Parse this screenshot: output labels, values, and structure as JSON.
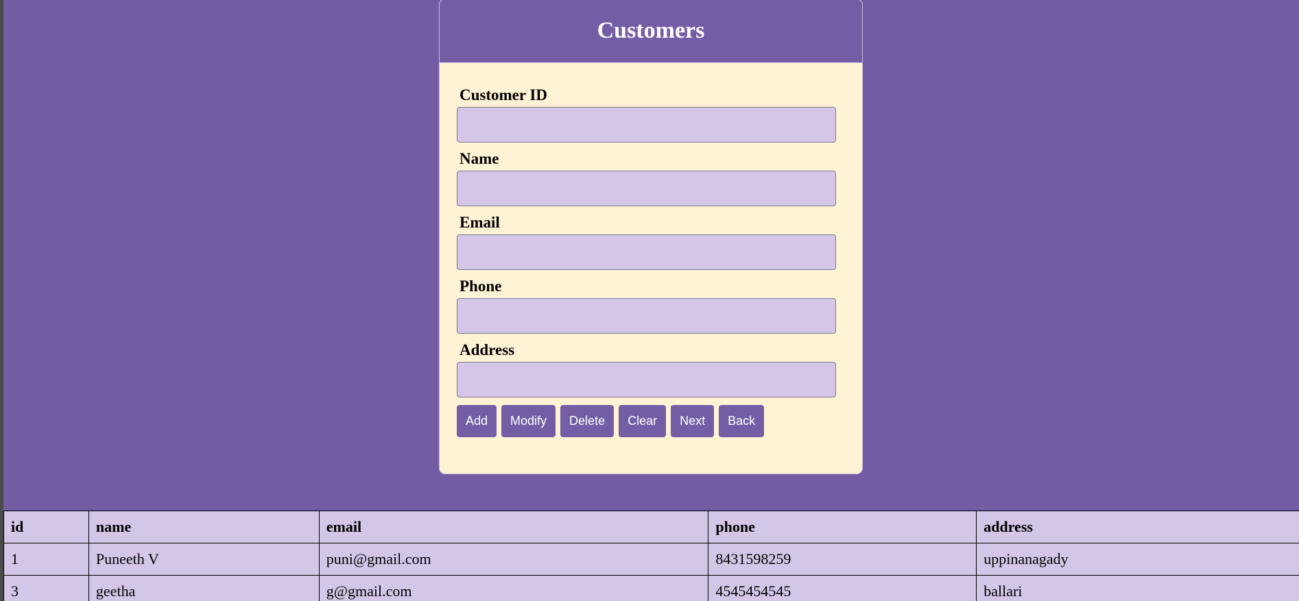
{
  "form": {
    "title": "Customers",
    "fields": [
      {
        "label": "Customer ID",
        "value": ""
      },
      {
        "label": "Name",
        "value": ""
      },
      {
        "label": "Email",
        "value": ""
      },
      {
        "label": "Phone",
        "value": ""
      },
      {
        "label": "Address",
        "value": ""
      }
    ],
    "buttons": [
      "Add",
      "Modify",
      "Delete",
      "Clear",
      "Next",
      "Back"
    ]
  },
  "table": {
    "headers": [
      "id",
      "name",
      "email",
      "phone",
      "address"
    ],
    "rows": [
      [
        "1",
        "Puneeth V",
        "puni@gmail.com",
        "8431598259",
        "uppinanagady"
      ],
      [
        "3",
        "geetha",
        "g@gmail.com",
        "4545454545",
        "ballari"
      ]
    ]
  },
  "colors": {
    "page_background": "#725da5",
    "card_background": "#fff3d6",
    "input_background": "#d4c6e7",
    "button_background": "#735ea6",
    "table_background": "#d4c6e7"
  }
}
